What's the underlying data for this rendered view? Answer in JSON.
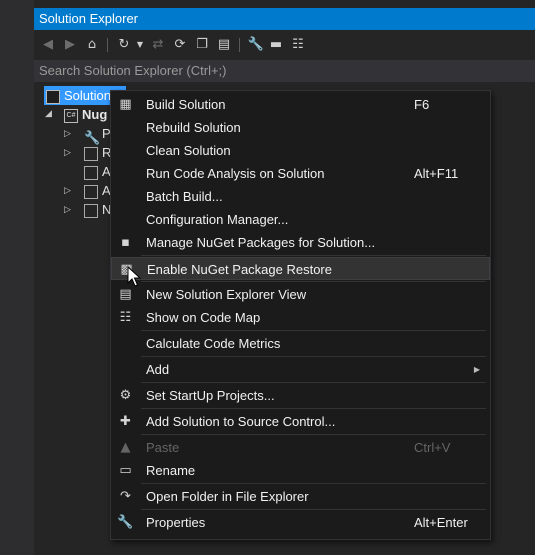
{
  "panel": {
    "title": "Solution Explorer",
    "search_placeholder": "Search Solution Explorer (Ctrl+;)"
  },
  "tree": {
    "solution_label": "Solution",
    "project_label": "Nug",
    "children": [
      "P",
      "R",
      "A",
      "A",
      "N"
    ]
  },
  "context_menu": {
    "groups": [
      [
        {
          "label": "Build Solution",
          "shortcut": "F6",
          "icon": "build-icon"
        },
        {
          "label": "Rebuild Solution",
          "shortcut": "",
          "icon": ""
        },
        {
          "label": "Clean Solution",
          "shortcut": "",
          "icon": ""
        },
        {
          "label": "Run Code Analysis on Solution",
          "shortcut": "Alt+F11",
          "icon": ""
        },
        {
          "label": "Batch Build...",
          "shortcut": "",
          "icon": ""
        },
        {
          "label": "Configuration Manager...",
          "shortcut": "",
          "icon": ""
        },
        {
          "label": "Manage NuGet Packages for Solution...",
          "shortcut": "",
          "icon": "nuget-icon"
        }
      ],
      [
        {
          "label": "Enable NuGet Package Restore",
          "shortcut": "",
          "icon": "package-restore-icon",
          "hover": true
        }
      ],
      [
        {
          "label": "New Solution Explorer View",
          "shortcut": "",
          "icon": "new-view-icon"
        },
        {
          "label": "Show on Code Map",
          "shortcut": "",
          "icon": "code-map-icon"
        }
      ],
      [
        {
          "label": "Calculate Code Metrics",
          "shortcut": "",
          "icon": ""
        }
      ],
      [
        {
          "label": "Add",
          "shortcut": "",
          "icon": "",
          "submenu": true
        }
      ],
      [
        {
          "label": "Set StartUp Projects...",
          "shortcut": "",
          "icon": "gear-icon"
        }
      ],
      [
        {
          "label": "Add Solution to Source Control...",
          "shortcut": "",
          "icon": "add-source-control-icon"
        }
      ],
      [
        {
          "label": "Paste",
          "shortcut": "Ctrl+V",
          "icon": "paste-icon",
          "disabled": true
        },
        {
          "label": "Rename",
          "shortcut": "",
          "icon": "rename-icon"
        }
      ],
      [
        {
          "label": "Open Folder in File Explorer",
          "shortcut": "",
          "icon": "open-folder-icon"
        }
      ],
      [
        {
          "label": "Properties",
          "shortcut": "Alt+Enter",
          "icon": "wrench-icon"
        }
      ]
    ]
  }
}
